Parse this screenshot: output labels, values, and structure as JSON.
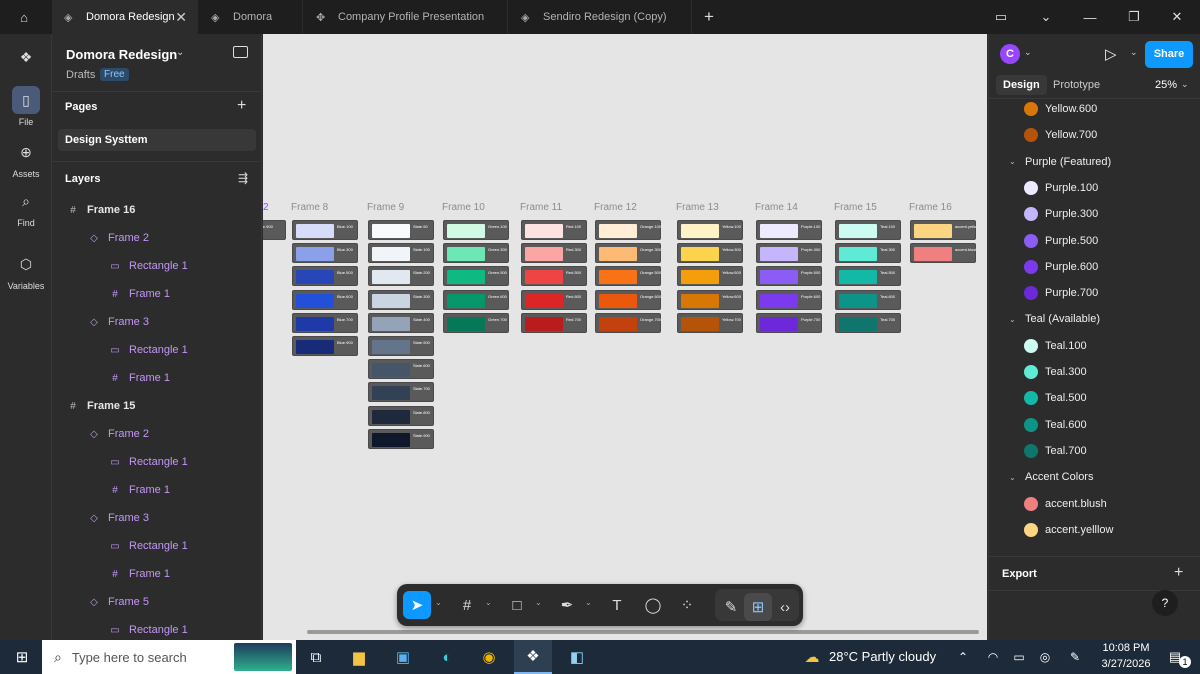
{
  "tabs": [
    {
      "label": "Domora Redesign",
      "active": true
    },
    {
      "label": "Domora"
    },
    {
      "label": "Company Profile Presentation"
    },
    {
      "label": "Sendiro Redesign (Copy)"
    }
  ],
  "rail": {
    "file": "File",
    "assets": "Assets",
    "find": "Find",
    "variables": "Variables"
  },
  "file": {
    "name": "Domora Redesign",
    "drafts": "Drafts",
    "plan": "Free"
  },
  "pages": {
    "title": "Pages",
    "items": [
      "Design Systtem"
    ]
  },
  "layers": {
    "title": "Layers",
    "items": [
      {
        "label": "Frame 16",
        "level": 0,
        "icon": "frame"
      },
      {
        "label": "Frame 2",
        "level": 1,
        "icon": "component"
      },
      {
        "label": "Rectangle 1",
        "level": 2,
        "icon": "rectangle"
      },
      {
        "label": "Frame 1",
        "level": 2,
        "icon": "frame"
      },
      {
        "label": "Frame 3",
        "level": 1,
        "icon": "component"
      },
      {
        "label": "Rectangle 1",
        "level": 2,
        "icon": "rectangle"
      },
      {
        "label": "Frame 1",
        "level": 2,
        "icon": "frame"
      },
      {
        "label": "Frame 15",
        "level": 0,
        "icon": "frame"
      },
      {
        "label": "Frame 2",
        "level": 1,
        "icon": "component"
      },
      {
        "label": "Rectangle 1",
        "level": 2,
        "icon": "rectangle"
      },
      {
        "label": "Frame 1",
        "level": 2,
        "icon": "frame"
      },
      {
        "label": "Frame 3",
        "level": 1,
        "icon": "component"
      },
      {
        "label": "Rectangle 1",
        "level": 2,
        "icon": "rectangle"
      },
      {
        "label": "Frame 1",
        "level": 2,
        "icon": "frame"
      },
      {
        "label": "Frame 5",
        "level": 1,
        "icon": "component"
      },
      {
        "label": "Rectangle 1",
        "level": 2,
        "icon": "rectangle"
      }
    ]
  },
  "canvas": {
    "partial_label": "2",
    "frames": [
      {
        "label": "",
        "items": [
          {
            "n": "Blue.900",
            "c": "#dfe3ea"
          }
        ]
      },
      {
        "label": "Frame 8",
        "items": [
          {
            "n": "Blue.100",
            "c": "#d6dcf9"
          },
          {
            "n": "Blue.300",
            "c": "#8aa0e8"
          },
          {
            "n": "Blue.500",
            "c": "#2746b8"
          },
          {
            "n": "Blue.600",
            "c": "#2350d8"
          },
          {
            "n": "Blue.700",
            "c": "#1e3aa8"
          },
          {
            "n": "Blue.900",
            "c": "#172b78"
          }
        ]
      },
      {
        "label": "Frame 9",
        "items": [
          {
            "n": "Slate.50",
            "c": "#f8fafc"
          },
          {
            "n": "Slate.100",
            "c": "#f1f5f9"
          },
          {
            "n": "Slate.200",
            "c": "#e2e8f0"
          },
          {
            "n": "Slate.300",
            "c": "#cbd5e1"
          },
          {
            "n": "Slate.400",
            "c": "#94a3b8"
          },
          {
            "n": "Slate.500",
            "c": "#64748b"
          },
          {
            "n": "Slate.600",
            "c": "#475569"
          },
          {
            "n": "Slate.700",
            "c": "#334155"
          },
          {
            "n": "Slate.800",
            "c": "#1e293b"
          },
          {
            "n": "Slate.900",
            "c": "#0f172a"
          }
        ]
      },
      {
        "label": "Frame 10",
        "items": [
          {
            "n": "Green.100",
            "c": "#d1fae5"
          },
          {
            "n": "Green.300",
            "c": "#6ee7b7"
          },
          {
            "n": "Green.500",
            "c": "#10b981"
          },
          {
            "n": "Green.600",
            "c": "#059669"
          },
          {
            "n": "Green.700",
            "c": "#047857"
          }
        ]
      },
      {
        "label": "Frame 11",
        "items": [
          {
            "n": "Red.100",
            "c": "#fee2e2"
          },
          {
            "n": "Red.300",
            "c": "#fca5a5"
          },
          {
            "n": "Red.500",
            "c": "#ef4444"
          },
          {
            "n": "Red.600",
            "c": "#dc2626"
          },
          {
            "n": "Red.700",
            "c": "#b91c1c"
          }
        ]
      },
      {
        "label": "Frame 12",
        "items": [
          {
            "n": "Orange.100",
            "c": "#ffedd5"
          },
          {
            "n": "Orange.300",
            "c": "#fdba74"
          },
          {
            "n": "Orange.500",
            "c": "#f97316"
          },
          {
            "n": "Orange.600",
            "c": "#ea580c"
          },
          {
            "n": "Orange.700",
            "c": "#c2410c"
          }
        ]
      },
      {
        "label": "Frame 13",
        "items": [
          {
            "n": "Yellow.100",
            "c": "#fef3c7"
          },
          {
            "n": "Yellow.300",
            "c": "#fcd34d"
          },
          {
            "n": "Yellow.500",
            "c": "#f59e0b"
          },
          {
            "n": "Yellow.600",
            "c": "#d97706"
          },
          {
            "n": "Yellow.700",
            "c": "#b45309"
          }
        ]
      },
      {
        "label": "Frame 14",
        "items": [
          {
            "n": "Purple.100",
            "c": "#ede9fe"
          },
          {
            "n": "Purple.300",
            "c": "#c4b5fd"
          },
          {
            "n": "Purple.500",
            "c": "#8b5cf6"
          },
          {
            "n": "Purple.600",
            "c": "#7c3aed"
          },
          {
            "n": "Purple.700",
            "c": "#6d28d9"
          }
        ]
      },
      {
        "label": "Frame 15",
        "items": [
          {
            "n": "Teal.100",
            "c": "#ccfbf1"
          },
          {
            "n": "Teal.300",
            "c": "#5eead4"
          },
          {
            "n": "Teal.500",
            "c": "#14b8a6"
          },
          {
            "n": "Teal.600",
            "c": "#0d9488"
          },
          {
            "n": "Teal.700",
            "c": "#0f766e"
          }
        ]
      },
      {
        "label": "Frame 16",
        "items": [
          {
            "n": "accent.yellow",
            "c": "#fcd581"
          },
          {
            "n": "accent.blush",
            "c": "#f08080"
          }
        ]
      }
    ]
  },
  "right": {
    "avatar": "C",
    "share": "Share",
    "design_tab": "Design",
    "prototype_tab": "Prototype",
    "zoom": "25%",
    "export": "Export",
    "help": "?",
    "colors": [
      {
        "label": "Yellow.600",
        "color": "#d97706"
      },
      {
        "label": "Yellow.700",
        "color": "#b45309"
      },
      {
        "label": "Purple (Featured)",
        "group": true
      },
      {
        "label": "Purple.100",
        "color": "#ede9fe"
      },
      {
        "label": "Purple.300",
        "color": "#c4b5fd"
      },
      {
        "label": "Purple.500",
        "color": "#8b5cf6"
      },
      {
        "label": "Purple.600",
        "color": "#7c3aed"
      },
      {
        "label": "Purple.700",
        "color": "#6d28d9"
      },
      {
        "label": "Teal (Available)",
        "group": true
      },
      {
        "label": "Teal.100",
        "color": "#ccfbf1"
      },
      {
        "label": "Teal.300",
        "color": "#5eead4"
      },
      {
        "label": "Teal.500",
        "color": "#14b8a6"
      },
      {
        "label": "Teal.600",
        "color": "#0d9488"
      },
      {
        "label": "Teal.700",
        "color": "#0f766e"
      },
      {
        "label": "Accent Colors",
        "group": true
      },
      {
        "label": "accent.blush",
        "color": "#f08080"
      },
      {
        "label": "accent.yelllow",
        "color": "#fcd581"
      }
    ]
  },
  "taskbar": {
    "search": "Type here to search",
    "weather": "28°C  Partly cloudy",
    "time": "10:08 PM",
    "date": "3/27/2026",
    "notif": "1"
  },
  "colors": {
    "accent": "#0d99ff",
    "purple_text": "#c397f5",
    "avatar": "#9747ff"
  }
}
